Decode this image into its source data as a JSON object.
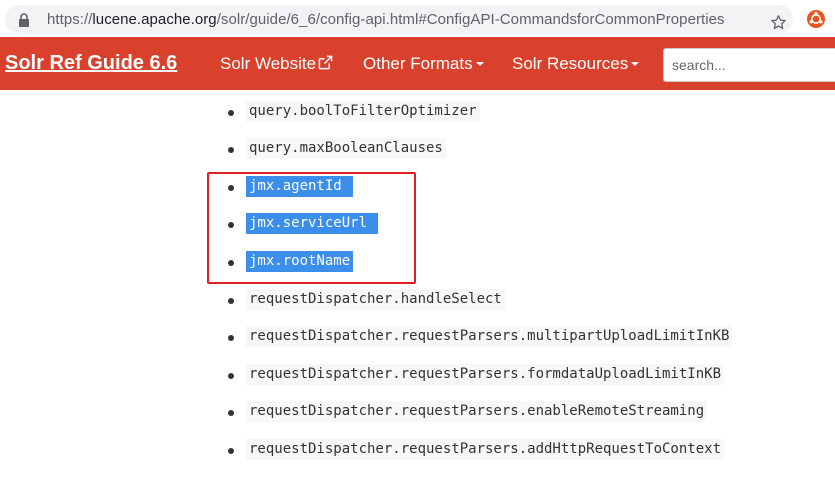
{
  "browser": {
    "url_scheme": "https://",
    "url_host": "lucene.apache.org",
    "url_path": "/solr/guide/6_6/config-api.html#ConfigAPI-CommandsforCommonProperties"
  },
  "navbar": {
    "brand": "Solr Ref Guide 6.6",
    "website": "Solr Website",
    "formats": "Other Formats",
    "resources": "Solr Resources",
    "search_placeholder": "search..."
  },
  "properties": [
    {
      "name": "query.boolToFilterOptimizer",
      "selected": false
    },
    {
      "name": "query.maxBooleanClauses",
      "selected": false
    },
    {
      "name": "jmx.agentId ",
      "selected": true
    },
    {
      "name": "jmx.serviceUrl ",
      "selected": true
    },
    {
      "name": "jmx.rootName",
      "selected": true
    },
    {
      "name": "requestDispatcher.handleSelect",
      "selected": false
    },
    {
      "name": "requestDispatcher.requestParsers.multipartUploadLimitInKB",
      "selected": false
    },
    {
      "name": "requestDispatcher.requestParsers.formdataUploadLimitInKB",
      "selected": false
    },
    {
      "name": "requestDispatcher.requestParsers.enableRemoteStreaming",
      "selected": false
    },
    {
      "name": "requestDispatcher.requestParsers.addHttpRequestToContext",
      "selected": false
    }
  ],
  "colors": {
    "navbar_bg": "#d9412c",
    "selection_bg": "#3b8eea",
    "highlight_border": "#e02020"
  }
}
